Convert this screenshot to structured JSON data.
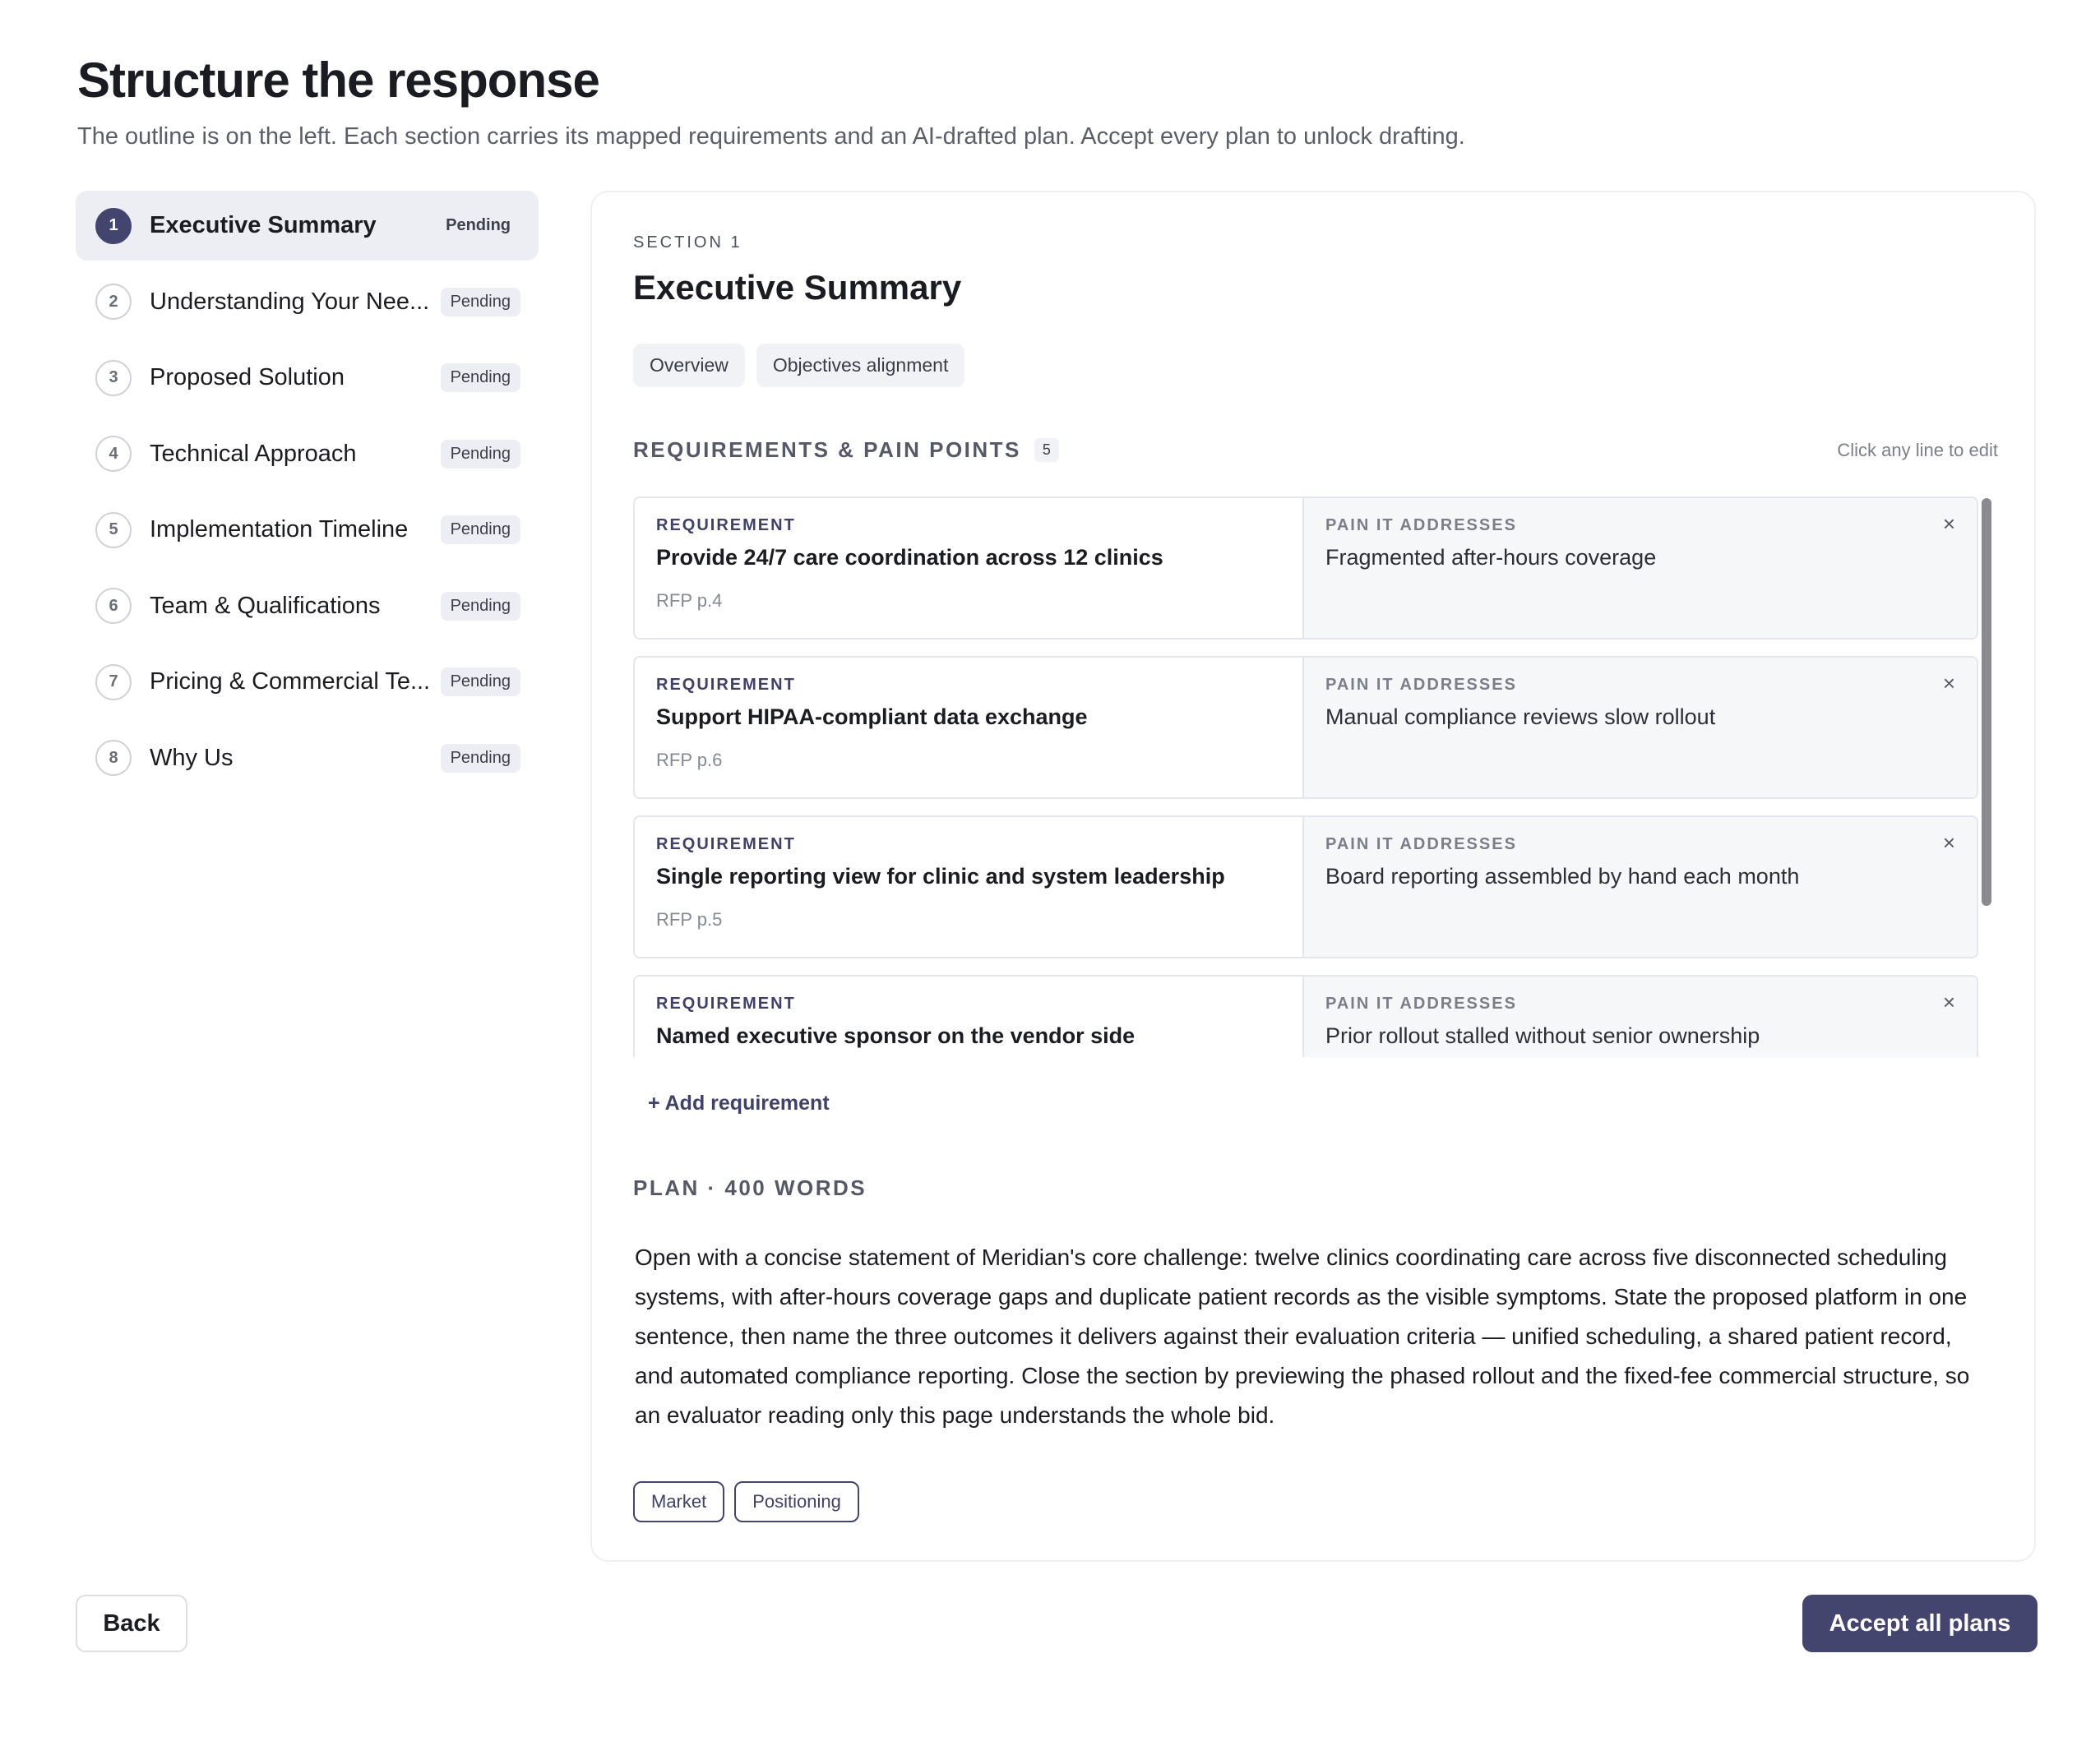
{
  "page": {
    "title": "Structure the response",
    "subtitle": "The outline is on the left. Each section carries its mapped requirements and an AI-drafted plan. Accept every plan to unlock drafting."
  },
  "sidebar": {
    "items": [
      {
        "num": "1",
        "label": "Executive Summary",
        "status": "Pending"
      },
      {
        "num": "2",
        "label": "Understanding Your Nee...",
        "status": "Pending"
      },
      {
        "num": "3",
        "label": "Proposed Solution",
        "status": "Pending"
      },
      {
        "num": "4",
        "label": "Technical Approach",
        "status": "Pending"
      },
      {
        "num": "5",
        "label": "Implementation Timeline",
        "status": "Pending"
      },
      {
        "num": "6",
        "label": "Team & Qualifications",
        "status": "Pending"
      },
      {
        "num": "7",
        "label": "Pricing & Commercial Te...",
        "status": "Pending"
      },
      {
        "num": "8",
        "label": "Why Us",
        "status": "Pending"
      }
    ]
  },
  "section": {
    "eyebrow": "SECTION 1",
    "title": "Executive Summary",
    "tags": [
      "Overview",
      "Objectives alignment"
    ]
  },
  "requirements": {
    "heading": "REQUIREMENTS & PAIN POINTS",
    "count": "5",
    "hint": "Click any line to edit",
    "req_label": "REQUIREMENT",
    "pain_label": "PAIN IT ADDRESSES",
    "close_glyph": "×",
    "rows": [
      {
        "requirement": "Provide 24/7 care coordination across 12 clinics",
        "ref": "RFP p.4",
        "pain": "Fragmented after-hours coverage"
      },
      {
        "requirement": "Support HIPAA-compliant data exchange",
        "ref": "RFP p.6",
        "pain": "Manual compliance reviews slow rollout"
      },
      {
        "requirement": "Single reporting view for clinic and system leadership",
        "ref": "RFP p.5",
        "pain": "Board reporting assembled by hand each month"
      },
      {
        "requirement": "Named executive sponsor on the vendor side",
        "ref": "",
        "pain": "Prior rollout stalled without senior ownership"
      }
    ],
    "add_label": "+ Add requirement"
  },
  "plan": {
    "heading": "PLAN · 400 WORDS",
    "body": "Open with a concise statement of Meridian's core challenge: twelve clinics coordinating care across five disconnected scheduling systems, with after-hours coverage gaps and duplicate patient records as the visible symptoms. State the proposed platform in one sentence, then name the three outcomes it delivers against their evaluation criteria — unified scheduling, a shared patient record, and automated compliance reporting. Close the section by previewing the phased rollout and the fixed-fee commercial structure, so an evaluator reading only this page understands the whole bid.",
    "tags": [
      "Market",
      "Positioning"
    ]
  },
  "footer": {
    "back_label": "Back",
    "accept_label": "Accept all plans"
  },
  "colors": {
    "accent": "#44456f",
    "active_bg": "#eceef3",
    "pain_bg": "#f6f7f9"
  }
}
